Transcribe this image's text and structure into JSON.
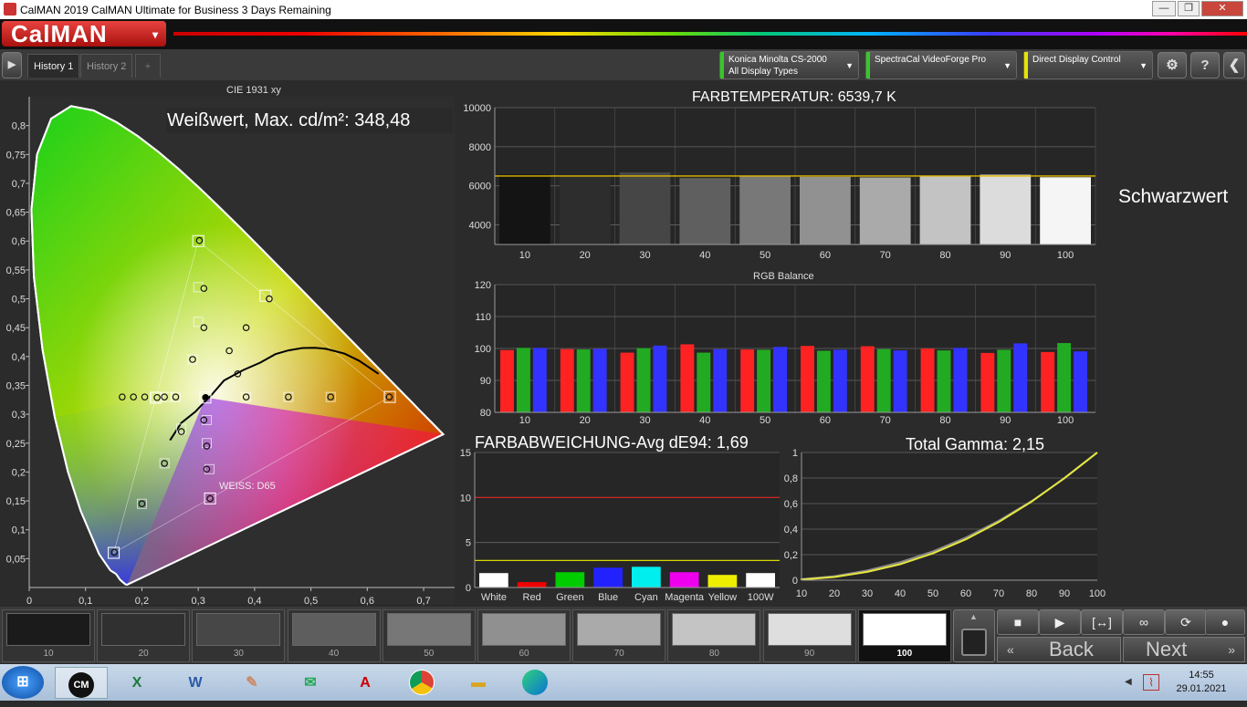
{
  "window": {
    "title": "CalMAN 2019 CalMAN Ultimate for Business 3 Days Remaining",
    "min": "—",
    "max": "❐",
    "close": "✕"
  },
  "brand": {
    "logo": "CalMAN",
    "dropdown": "▾"
  },
  "tabs": [
    {
      "label": "History 1"
    },
    {
      "label": "History 2"
    },
    {
      "label": "+"
    }
  ],
  "devices": [
    {
      "line1": "Konica Minolta CS-2000",
      "line2": "All Display Types",
      "color": "#34c924"
    },
    {
      "line1": "SpectraCal VideoForge Pro",
      "line2": "",
      "color": "#34c924"
    },
    {
      "line1": "Direct Display Control",
      "line2": "",
      "color": "#e8e200"
    }
  ],
  "toolbar_icons": {
    "play": "▶",
    "settings": "⚙",
    "help": "?",
    "collapse": "❮"
  },
  "cie": {
    "title": "CIE 1931 xy",
    "white_label": "Weißwert, Max. cd/m²: 348,48",
    "target_label": "WEISS: D65",
    "x_ticks": [
      "0",
      "0,1",
      "0,2",
      "0,3",
      "0,4",
      "0,5",
      "0,6",
      "0,7"
    ],
    "y_ticks": [
      "0,05",
      "0,1",
      "0,15",
      "0,2",
      "0,25",
      "0,3",
      "0,35",
      "0,4",
      "0,45",
      "0,5",
      "0,55",
      "0,6",
      "0,65",
      "0,7",
      "0,75",
      "0,8"
    ]
  },
  "colortemp": {
    "title": "FARBTEMPERATUR: 6539,7 K",
    "y_ticks": [
      "4000",
      "6000",
      "8000",
      "10000"
    ],
    "categories": [
      "10",
      "20",
      "30",
      "40",
      "50",
      "60",
      "70",
      "80",
      "90",
      "100"
    ]
  },
  "black_level_label": "Schwarzwert",
  "rgb": {
    "title": "RGB Balance",
    "y_ticks": [
      "80",
      "90",
      "100",
      "110",
      "120"
    ],
    "categories": [
      "10",
      "20",
      "30",
      "40",
      "50",
      "60",
      "70",
      "80",
      "90",
      "100"
    ]
  },
  "de": {
    "title": "FARBABWEICHUNG-Avg dE94: 1,69",
    "y_ticks": [
      "0",
      "5",
      "10",
      "15"
    ],
    "categories": [
      "White",
      "Red",
      "Green",
      "Blue",
      "Cyan",
      "Magenta",
      "Yellow",
      "100W"
    ]
  },
  "gamma": {
    "title": "Total Gamma: 2,15",
    "y_ticks": [
      "0",
      "0,2",
      "0,4",
      "0,6",
      "0,8",
      "1"
    ],
    "x_ticks": [
      "10",
      "20",
      "30",
      "40",
      "50",
      "60",
      "70",
      "80",
      "90",
      "100"
    ]
  },
  "swatches": [
    {
      "label": "10",
      "color": "#1b1b1b"
    },
    {
      "label": "20",
      "color": "#303030"
    },
    {
      "label": "30",
      "color": "#474747"
    },
    {
      "label": "40",
      "color": "#5e5e5e"
    },
    {
      "label": "50",
      "color": "#777777"
    },
    {
      "label": "60",
      "color": "#909090"
    },
    {
      "label": "70",
      "color": "#aaaaaa"
    },
    {
      "label": "80",
      "color": "#c4c4c4"
    },
    {
      "label": "90",
      "color": "#dedede"
    },
    {
      "label": "100",
      "color": "#ffffff"
    }
  ],
  "controls": {
    "stop": "■",
    "play": "▶",
    "fit": "[↔]",
    "loop": "∞",
    "refresh": "⟳",
    "back": "Back",
    "next": "Next"
  },
  "taskbar": {
    "time": "14:55",
    "date": "29.01.2021",
    "start": "⊞",
    "arrow": "◀"
  },
  "chart_data": [
    {
      "type": "scatter",
      "title": "CIE 1931 xy",
      "xlim": [
        0,
        0.75
      ],
      "ylim": [
        0,
        0.85
      ],
      "series": [
        {
          "name": "",
          "points": [
            [
              0.64,
              0.33
            ],
            [
              0.3,
              0.6
            ],
            [
              0.15,
              0.06
            ],
            [
              0.3127,
              0.329
            ],
            [
              0.2246,
              0.3287
            ],
            [
              0.3209,
              0.1542
            ],
            [
              0.4193,
              0.5053
            ]
          ]
        },
        {
          "name": "",
          "points": [
            [
              0.639,
              0.33
            ],
            [
              0.302,
              0.601
            ],
            [
              0.151,
              0.061
            ],
            [
              0.313,
              0.329
            ],
            [
              0.227,
              0.329
            ],
            [
              0.321,
              0.154
            ],
            [
              0.426,
              0.5
            ],
            [
              0.31,
              0.518
            ],
            [
              0.31,
              0.45
            ],
            [
              0.29,
              0.395
            ],
            [
              0.355,
              0.41
            ],
            [
              0.37,
              0.37
            ],
            [
              0.385,
              0.45
            ],
            [
              0.535,
              0.33
            ],
            [
              0.46,
              0.33
            ],
            [
              0.385,
              0.33
            ],
            [
              0.26,
              0.33
            ],
            [
              0.24,
              0.33
            ],
            [
              0.205,
              0.33
            ],
            [
              0.185,
              0.33
            ],
            [
              0.165,
              0.33
            ],
            [
              0.315,
              0.245
            ],
            [
              0.315,
              0.205
            ],
            [
              0.31,
              0.29
            ],
            [
              0.27,
              0.27
            ],
            [
              0.24,
              0.215
            ],
            [
              0.2,
              0.145
            ]
          ]
        }
      ]
    },
    {
      "type": "bar",
      "title": "FARBTEMPERATUR: 6539,7 K",
      "categories": [
        "10",
        "20",
        "30",
        "40",
        "50",
        "60",
        "70",
        "80",
        "90",
        "100"
      ],
      "values": [
        6580,
        6520,
        6690,
        6400,
        6500,
        6460,
        6430,
        6500,
        6570,
        6440
      ],
      "ylim": [
        3000,
        10000
      ],
      "target": 6504
    },
    {
      "type": "bar",
      "title": "RGB Balance",
      "categories": [
        "10",
        "20",
        "30",
        "40",
        "50",
        "60",
        "70",
        "80",
        "90",
        "100"
      ],
      "series": [
        {
          "name": "",
          "values": [
            99.5,
            99.8,
            98.7,
            101.3,
            99.7,
            100.8,
            100.7,
            100.0,
            98.6,
            98.9
          ]
        },
        {
          "name": "",
          "values": [
            100.2,
            99.7,
            100.1,
            98.7,
            99.6,
            99.3,
            99.8,
            99.4,
            99.6,
            101.7
          ]
        },
        {
          "name": "",
          "values": [
            100.2,
            99.9,
            100.9,
            99.8,
            100.5,
            99.6,
            99.4,
            100.2,
            101.6,
            99.1
          ]
        }
      ],
      "ylim": [
        80,
        120
      ]
    },
    {
      "type": "bar",
      "title": "FARBABWEICHUNG-Avg dE94: 1,69",
      "categories": [
        "White",
        "Red",
        "Green",
        "Blue",
        "Cyan",
        "Magenta",
        "Yellow",
        "100W"
      ],
      "values": [
        1.6,
        0.6,
        1.7,
        2.2,
        2.3,
        1.7,
        1.4,
        1.6
      ],
      "ylim": [
        0,
        15
      ],
      "thresholds": [
        3,
        10
      ]
    },
    {
      "type": "line",
      "title": "Total Gamma: 2,15",
      "x": [
        0,
        10,
        20,
        30,
        40,
        50,
        60,
        70,
        80,
        90,
        100
      ],
      "series": [
        {
          "name": "",
          "values": [
            0.0,
            0.007,
            0.031,
            0.075,
            0.14,
            0.225,
            0.333,
            0.464,
            0.618,
            0.797,
            1.0
          ]
        },
        {
          "name": "",
          "values": [
            0.0,
            0.005,
            0.025,
            0.065,
            0.125,
            0.21,
            0.32,
            0.455,
            0.615,
            0.8,
            1.0
          ]
        }
      ],
      "xlim": [
        10,
        100
      ],
      "ylim": [
        0,
        1
      ]
    }
  ]
}
